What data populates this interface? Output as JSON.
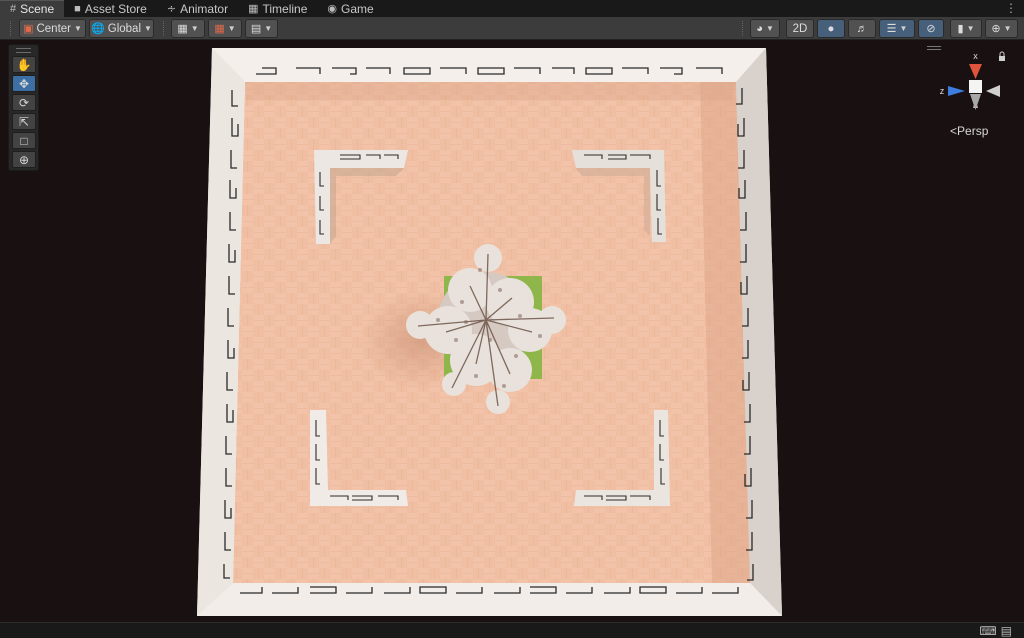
{
  "tabs": [
    {
      "label": "Scene",
      "icon": "grid-icon",
      "active": true
    },
    {
      "label": "Asset Store",
      "icon": "bag-icon",
      "active": false
    },
    {
      "label": "Animator",
      "icon": "animator-icon",
      "active": false
    },
    {
      "label": "Timeline",
      "icon": "film-icon",
      "active": false
    },
    {
      "label": "Game",
      "icon": "gamepad-icon",
      "active": false
    }
  ],
  "toolbar": {
    "pivot_label": "Center",
    "space_label": "Global",
    "mode_2d_label": "2D"
  },
  "tools": [
    "hand-tool",
    "move-tool",
    "rotate-tool",
    "scale-tool",
    "rect-tool",
    "transform-tool"
  ],
  "gizmo": {
    "x_label": "x",
    "z_label": "z",
    "projection_label": "Persp",
    "colors": {
      "x": "#e0533c",
      "z": "#3d7de0",
      "y": "#d0d0d0"
    }
  },
  "colors": {
    "floor": "#f1bfa3",
    "wall": "#ebe7e3",
    "grass": "#8fb64a",
    "accent_active": "#3e6fa4"
  }
}
